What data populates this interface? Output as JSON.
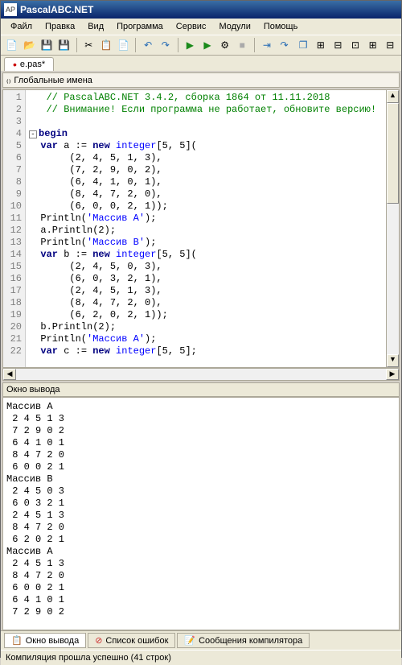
{
  "titlebar": {
    "text": "PascalABC.NET"
  },
  "menu": {
    "file": "Файл",
    "edit": "Правка",
    "view": "Вид",
    "program": "Программа",
    "service": "Сервис",
    "modules": "Модули",
    "help": "Помощь"
  },
  "tabs": {
    "file": "e.pas*"
  },
  "names_bar": "Глобальные имена",
  "code": {
    "lines": [
      {
        "n": 1,
        "comment": "// PascalABC.NET 3.4.2, сборка 1864 от 11.11.2018"
      },
      {
        "n": 2,
        "comment": "// Внимание! Если программа не работает, обновите версию!"
      },
      {
        "n": 3,
        "blank": true
      },
      {
        "n": 4,
        "kw": "begin",
        "fold": true
      },
      {
        "n": 5,
        "indent": "  ",
        "kw": "var",
        "rest": " a := ",
        "kw2": "new",
        "type": " integer",
        "tail": "[5, 5]("
      },
      {
        "n": 6,
        "raw": "       (2, 4, 5, 1, 3),"
      },
      {
        "n": 7,
        "raw": "       (7, 2, 9, 0, 2),"
      },
      {
        "n": 8,
        "raw": "       (6, 4, 1, 0, 1),"
      },
      {
        "n": 9,
        "raw": "       (8, 4, 7, 2, 0),"
      },
      {
        "n": 10,
        "raw": "       (6, 0, 0, 2, 1));"
      },
      {
        "n": 11,
        "call": "  Println(",
        "str": "'Массив A'",
        "after": ");"
      },
      {
        "n": 12,
        "raw": "  a.Println(2);"
      },
      {
        "n": 13,
        "call": "  Println(",
        "str": "'Массив B'",
        "after": ");"
      },
      {
        "n": 14,
        "indent": "  ",
        "kw": "var",
        "rest": " b := ",
        "kw2": "new",
        "type": " integer",
        "tail": "[5, 5]("
      },
      {
        "n": 15,
        "raw": "       (2, 4, 5, 0, 3),"
      },
      {
        "n": 16,
        "raw": "       (6, 0, 3, 2, 1),"
      },
      {
        "n": 17,
        "raw": "       (2, 4, 5, 1, 3),"
      },
      {
        "n": 18,
        "raw": "       (8, 4, 7, 2, 0),"
      },
      {
        "n": 19,
        "raw": "       (6, 2, 0, 2, 1));"
      },
      {
        "n": 20,
        "raw": "  b.Println(2);"
      },
      {
        "n": 21,
        "call": "  Println(",
        "str": "'Массив A'",
        "after": ");"
      },
      {
        "n": 22,
        "indent": "  ",
        "kw": "var",
        "rest": " c := ",
        "kw2": "new",
        "type": " integer",
        "tail": "[5, 5];"
      }
    ]
  },
  "output": {
    "header": "Окно вывода",
    "text": "Массив A\n 2 4 5 1 3\n 7 2 9 0 2\n 6 4 1 0 1\n 8 4 7 2 0\n 6 0 0 2 1\nМассив B\n 2 4 5 0 3\n 6 0 3 2 1\n 2 4 5 1 3\n 8 4 7 2 0\n 6 2 0 2 1\nМассив A\n 2 4 5 1 3\n 8 4 7 2 0\n 6 0 0 2 1\n 6 4 1 0 1\n 7 2 9 0 2"
  },
  "bottom_tabs": {
    "output": "Окно вывода",
    "errors": "Список ошибок",
    "compiler": "Сообщения компилятора"
  },
  "statusbar": "Компиляция прошла успешно (41 строк)"
}
